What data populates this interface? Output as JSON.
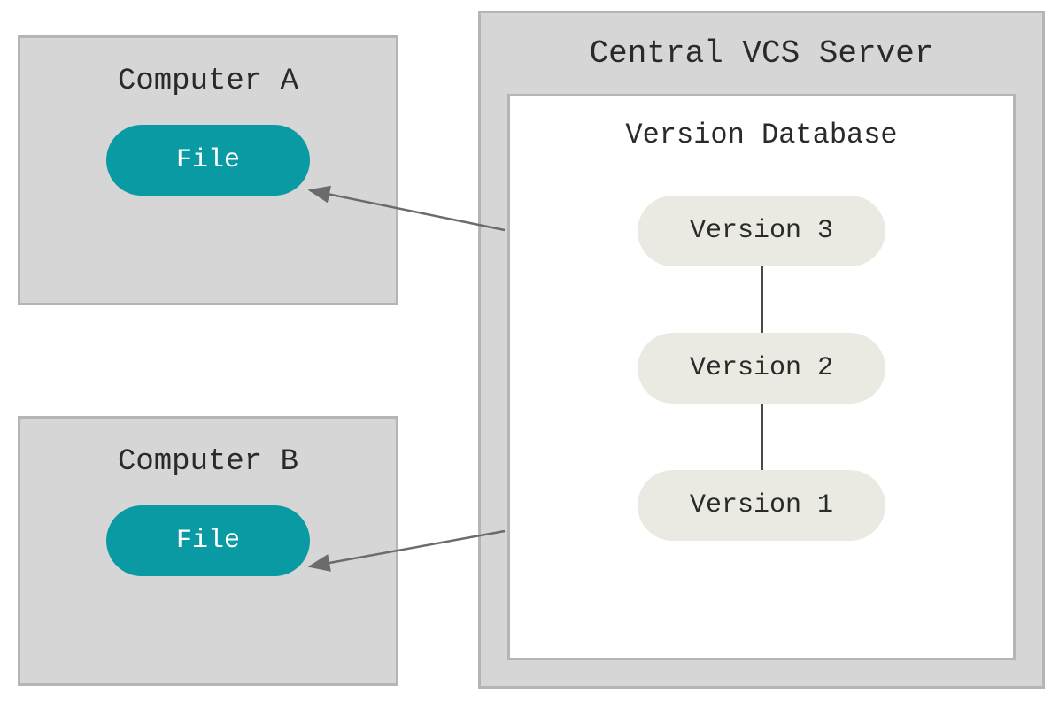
{
  "computer_a": {
    "title": "Computer A",
    "file_label": "File"
  },
  "computer_b": {
    "title": "Computer B",
    "file_label": "File"
  },
  "server": {
    "title": "Central VCS Server",
    "database": {
      "title": "Version Database",
      "versions": {
        "v3": "Version 3",
        "v2": "Version 2",
        "v1": "Version 1"
      }
    }
  },
  "colors": {
    "box_bg": "#d6d6d6",
    "box_border": "#b5b5b5",
    "file_pill": "#0a9aa3",
    "version_pill": "#eaeae3",
    "arrow": "#6b6b6b"
  }
}
